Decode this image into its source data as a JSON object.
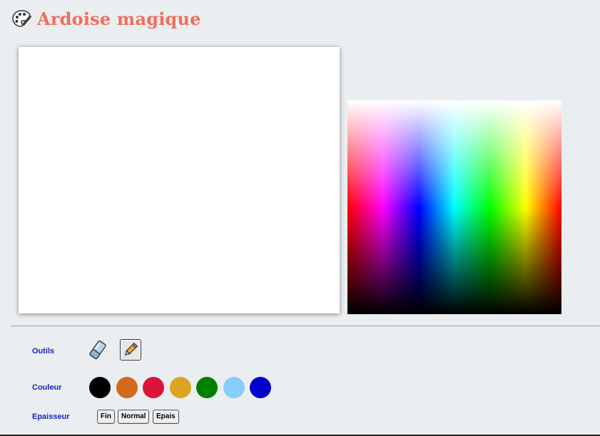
{
  "header": {
    "title": "Ardoise magique",
    "icon": "palette-icon"
  },
  "colors": {
    "title": "#f26d5b",
    "labels": "#1a23c4",
    "background": "#ebeef0"
  },
  "drawing_area": {
    "background": "#ffffff"
  },
  "color_picker": {
    "type": "hue-lightness-gradient"
  },
  "controls": {
    "tools_label": "Outils",
    "tools": [
      {
        "name": "eraser-icon"
      },
      {
        "name": "pencil-icon",
        "selected": true
      }
    ],
    "color_label": "Couleur",
    "swatches": [
      "#000000",
      "#d2691e",
      "#dc143c",
      "#daa520",
      "#008000",
      "#87cefa",
      "#0000cd"
    ],
    "thickness_label": "Epaisseur",
    "thickness": [
      "Fin",
      "Normal",
      "Epais"
    ]
  }
}
